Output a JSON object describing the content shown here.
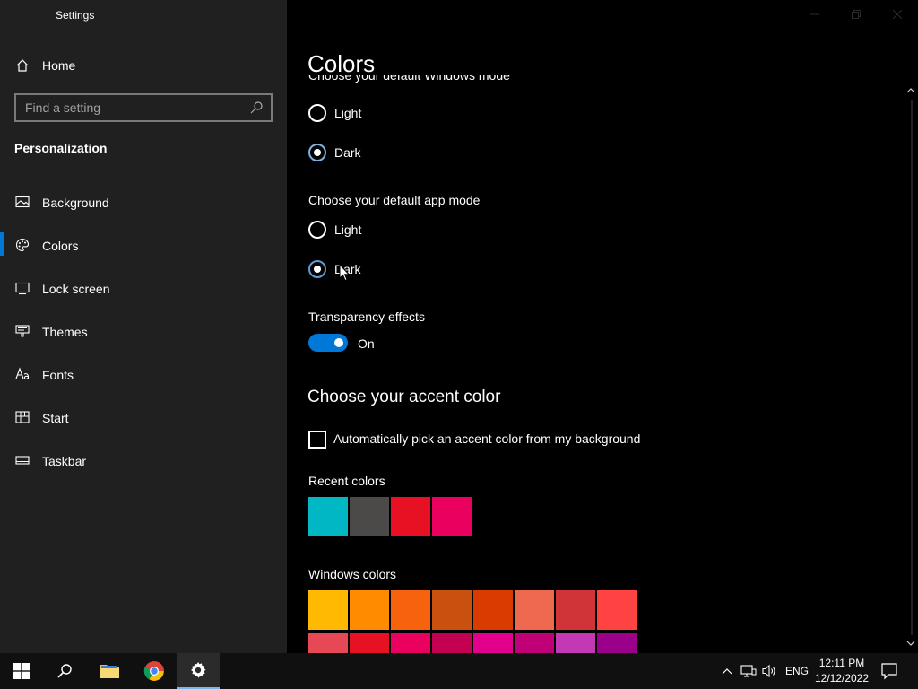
{
  "window": {
    "title": "Settings"
  },
  "sidebar": {
    "home_label": "Home",
    "search_placeholder": "Find a setting",
    "section_title": "Personalization",
    "items": [
      {
        "label": "Background",
        "icon": "image-icon"
      },
      {
        "label": "Colors",
        "icon": "palette-icon",
        "active": true
      },
      {
        "label": "Lock screen",
        "icon": "lock-screen-icon"
      },
      {
        "label": "Themes",
        "icon": "brush-icon"
      },
      {
        "label": "Fonts",
        "icon": "fonts-icon"
      },
      {
        "label": "Start",
        "icon": "start-icon"
      },
      {
        "label": "Taskbar",
        "icon": "taskbar-icon"
      }
    ]
  },
  "main": {
    "title": "Colors",
    "windows_mode": {
      "heading_clipped": "Choose your default Windows mode",
      "options": [
        "Light",
        "Dark"
      ],
      "selected": "Dark"
    },
    "app_mode": {
      "heading": "Choose your default app mode",
      "options": [
        "Light",
        "Dark"
      ],
      "selected": "Dark"
    },
    "transparency": {
      "heading": "Transparency effects",
      "state_label": "On"
    },
    "accent": {
      "heading": "Choose your accent color",
      "auto_checkbox_label": "Automatically pick an accent color from my background",
      "recent_label": "Recent colors",
      "recent_colors": [
        "#00b7c3",
        "#4c4a48",
        "#e81123",
        "#ea005e"
      ],
      "windows_label": "Windows colors",
      "windows_colors_row1": [
        "#ffb900",
        "#ff8c00",
        "#f7630c",
        "#ca5010",
        "#da3b01",
        "#ef6950",
        "#d13438",
        "#ff4343"
      ],
      "windows_colors_row2": [
        "#e74856",
        "#e81123",
        "#ea005e",
        "#c30052",
        "#e3008c",
        "#bf0077",
        "#c239b3",
        "#9a0089"
      ]
    }
  },
  "taskbar": {
    "language": "ENG",
    "time": "12:11 PM",
    "date": "12/12/2022"
  },
  "colors": {
    "accent": "#0078d7",
    "sidebar_bg": "#202020",
    "main_bg": "#000000"
  }
}
